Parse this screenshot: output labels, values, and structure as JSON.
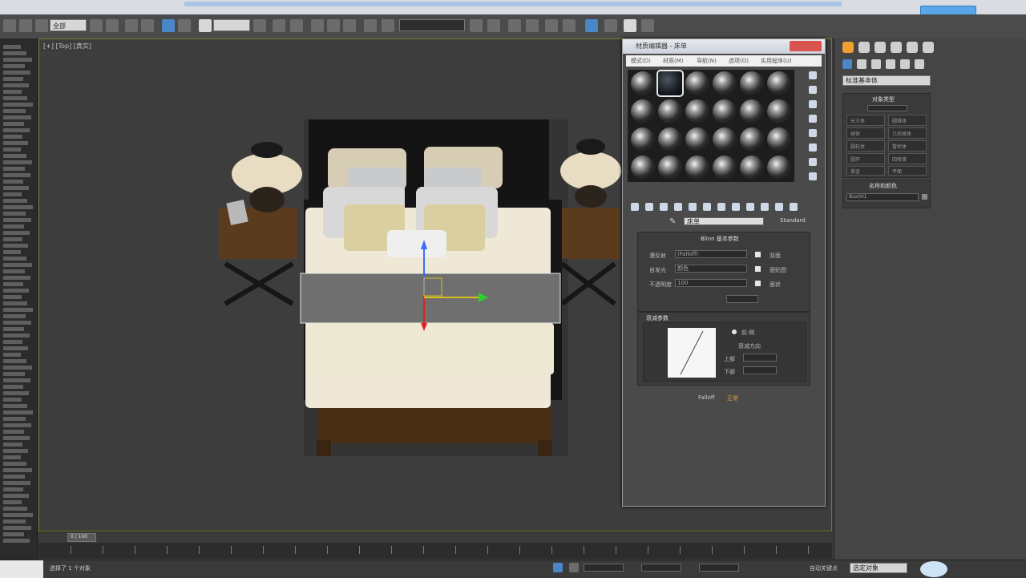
{
  "toolbar": {
    "selection_filter": "全部",
    "named_selection": ""
  },
  "viewport": {
    "label": "[+] [Top] [真实]",
    "mesh_label": ""
  },
  "material_editor": {
    "window_title": "材质编辑器 - 床单",
    "menus": [
      "模式(D)",
      "材质(M)",
      "导航(N)",
      "选项(O)",
      "实用程序(U)"
    ],
    "material_name": "床单",
    "material_type": "Standard",
    "basic_params_title": "Blinn 基本参数",
    "rows": [
      {
        "label": "漫反射",
        "value": "(Falloff)",
        "option": "双面"
      },
      {
        "label": "自发光",
        "value": "颜色",
        "option": "面贴图"
      },
      {
        "label": "不透明度",
        "value": "100",
        "option": "面状"
      }
    ],
    "falloff_title": "衰减参数",
    "falloff_options": [
      "前:侧",
      "衰减方向"
    ],
    "falloff_labels": [
      "正常",
      "上部",
      "下部"
    ],
    "bottom_label": "Falloff"
  },
  "command_panel": {
    "dropdown": "标准基本体",
    "object_type_title": "对象类型",
    "buttons": [
      "长方体",
      "圆锥体",
      "球体",
      "几何球体",
      "圆柱体",
      "管状体",
      "圆环",
      "四棱锥",
      "茶壶",
      "平面"
    ],
    "name_color_title": "名称和颜色",
    "name_value": "Box001"
  },
  "bottom": {
    "frame_display": "0 / 100",
    "status_text": "选择了 1 个对象",
    "key_mode": "自动关键点",
    "selected_dropdown": "选定对象"
  },
  "colors": {
    "viewport_bg": "#3d3d3d",
    "panel_bg": "#4a4a4a",
    "accent_blue": "#4a86c8",
    "accent_orange": "#f0a030"
  }
}
